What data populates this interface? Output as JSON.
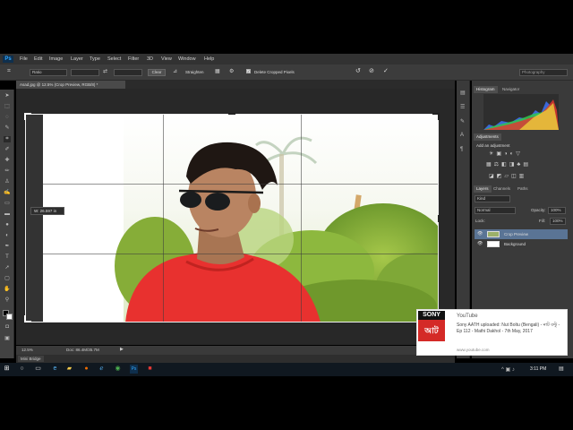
{
  "app": {
    "logo": "Ps"
  },
  "menu": [
    "File",
    "Edit",
    "Image",
    "Layer",
    "Type",
    "Select",
    "Filter",
    "3D",
    "View",
    "Window",
    "Help"
  ],
  "options": {
    "ratio": "Ratio",
    "clear": "Clear",
    "straighten": "Straighten",
    "delete_cropped": "Delete Cropped Pixels",
    "workspace": "Photography"
  },
  "document": {
    "tab_title": "Asad.jpg @ 12.5% (Crop Preview, RGB/8) *"
  },
  "crop_tooltip": "W:   26.597 in",
  "status": {
    "zoom": "12.5%",
    "doc": "Doc: 86.4M/35.7M"
  },
  "mini_bridge": "Mini Bridge",
  "panels": {
    "histogram_tab": "Histogram",
    "navigator_tab": "Navigator",
    "adjustments_tab": "Adjustments",
    "add_adjustment": "Add an adjustment",
    "layers_tab": "Layers",
    "channels_tab": "Channels",
    "paths_tab": "Paths",
    "kind": "Kind",
    "blend_mode": "Normal",
    "opacity_label": "Opacity:",
    "opacity_value": "100%",
    "lock_label": "Lock:",
    "fill_label": "Fill:",
    "fill_value": "100%",
    "layers": [
      {
        "name": "Crop Preview"
      },
      {
        "name": "Background"
      }
    ]
  },
  "youtube": {
    "title": "YouTube",
    "body": "Sony AATH uploaded: Nut Boltu (Bengali) - নাট বল্টু - Ep 112 - Mathi Dakhol - 7th May, 2017",
    "url": "www.youtube.com",
    "logo_top": "SONY",
    "logo_bottom": "আট"
  },
  "taskbar": {
    "time": "3:11 PM"
  },
  "colors": {
    "accent": "#31a8ff",
    "menubar": "#323232",
    "panel": "#3a3a3a",
    "shirt": "#e8312f"
  }
}
